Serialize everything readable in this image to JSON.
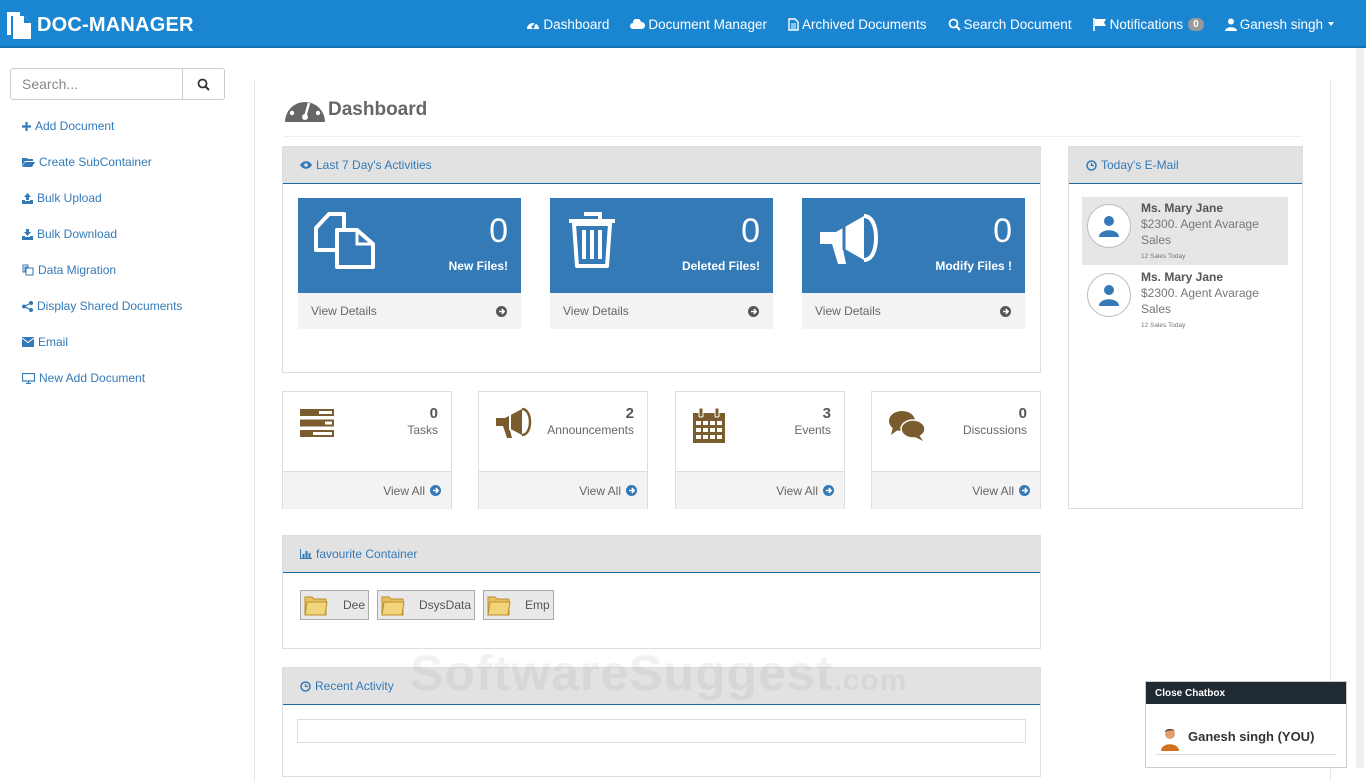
{
  "brand": {
    "name": "DOC-MANAGER"
  },
  "nav": {
    "dashboard": "Dashboard",
    "document_manager": "Document Manager",
    "archived": "Archived Documents",
    "search": "Search Document",
    "notifications": "Notifications",
    "notifications_count": "0",
    "user": "Ganesh singh"
  },
  "sidebar": {
    "search_placeholder": "Search...",
    "items": [
      {
        "label": "Add Document",
        "icon": "plus-icon"
      },
      {
        "label": "Create SubContainer",
        "icon": "folder-open-icon"
      },
      {
        "label": "Bulk Upload",
        "icon": "upload-icon"
      },
      {
        "label": "Bulk Download",
        "icon": "download-icon"
      },
      {
        "label": "Data Migration",
        "icon": "copy-icon"
      },
      {
        "label": "Display Shared Documents",
        "icon": "share-icon"
      },
      {
        "label": "Email",
        "icon": "envelope-icon"
      },
      {
        "label": "New Add Document",
        "icon": "desktop-icon"
      }
    ]
  },
  "page": {
    "title": "Dashboard"
  },
  "activities": {
    "title": "Last 7 Day's Activities",
    "stats": [
      {
        "value": "0",
        "label": "New Files!",
        "link": "View Details",
        "icon": "files-icon"
      },
      {
        "value": "0",
        "label": "Deleted Files!",
        "link": "View Details",
        "icon": "trash-icon"
      },
      {
        "value": "0",
        "label": "Modify Files !",
        "link": "View Details",
        "icon": "bullhorn-icon"
      }
    ]
  },
  "cards": [
    {
      "value": "0",
      "label": "Tasks",
      "link": "View All",
      "icon": "tasks-icon"
    },
    {
      "value": "2",
      "label": "Announcements",
      "link": "View All",
      "icon": "bullhorn-icon"
    },
    {
      "value": "3",
      "label": "Events",
      "link": "View All",
      "icon": "calendar-icon"
    },
    {
      "value": "0",
      "label": "Discussions",
      "link": "View All",
      "icon": "comments-icon"
    }
  ],
  "favourite": {
    "title": "favourite Container",
    "folders": [
      "Dee",
      "DsysData",
      "Emp"
    ]
  },
  "recent": {
    "title": "Recent Activity"
  },
  "email": {
    "title": "Today's E-Mail",
    "items": [
      {
        "name": "Ms. Mary Jane",
        "desc": "$2300. Agent Avarage Sales",
        "note": "12 Sales Today"
      },
      {
        "name": "Ms. Mary Jane",
        "desc": "$2300. Agent Avarage Sales",
        "note": "12 Sales Today"
      }
    ]
  },
  "chat": {
    "header": "Close Chatbox",
    "user": "Ganesh singh (YOU)"
  },
  "watermark": {
    "text": "SoftwareSuggest",
    "suffix": ".com"
  },
  "colors": {
    "navbar": "#1a86d1",
    "tile": "#337ab7",
    "link": "#337ab7",
    "icon_brown": "#7a5c2e"
  }
}
